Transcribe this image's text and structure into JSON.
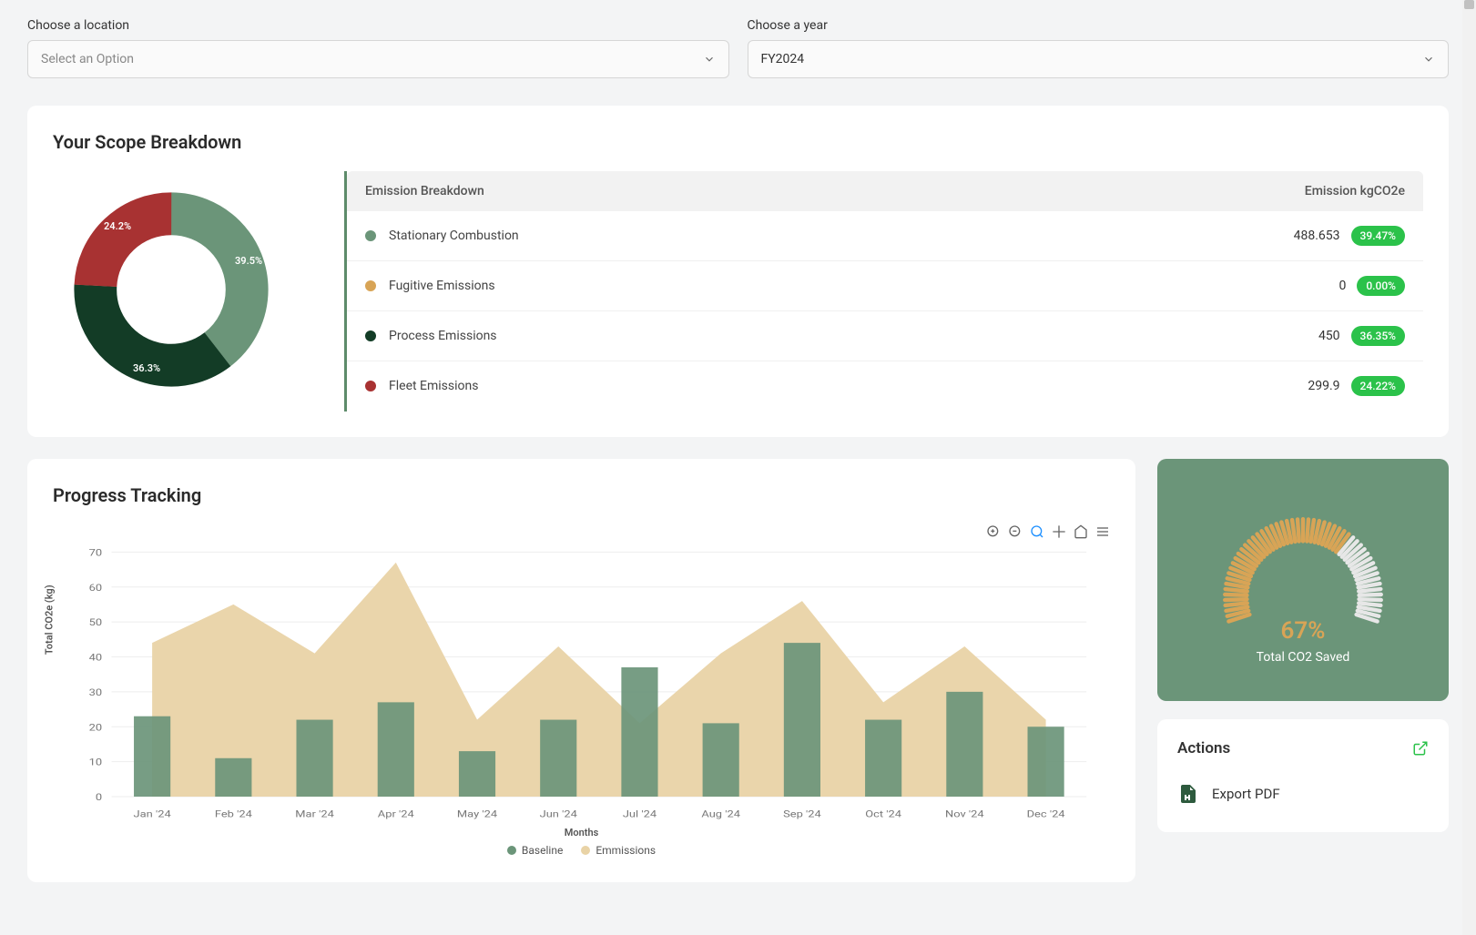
{
  "filters": {
    "location_label": "Choose a location",
    "location_placeholder": "Select an Option",
    "year_label": "Choose a year",
    "year_value": "FY2024"
  },
  "scope": {
    "title": "Your Scope Breakdown",
    "table_head_left": "Emission Breakdown",
    "table_head_right": "Emission kgCO2e",
    "rows": [
      {
        "name": "Stationary Combustion",
        "value": "488.653",
        "pct": "39.47%",
        "color": "#6b9579"
      },
      {
        "name": "Fugitive Emissions",
        "value": "0",
        "pct": "0.00%",
        "color": "#d8a456"
      },
      {
        "name": "Process Emissions",
        "value": "450",
        "pct": "36.35%",
        "color": "#133c26"
      },
      {
        "name": "Fleet Emissions",
        "value": "299.9",
        "pct": "24.22%",
        "color": "#a83232"
      }
    ],
    "donut_labels": {
      "a": "39.5%",
      "b": "36.3%",
      "c": "24.2%"
    }
  },
  "progress": {
    "title": "Progress Tracking",
    "y_label": "Total CO2e (kg)",
    "x_label": "Months",
    "legend_a": "Baseline",
    "legend_b": "Emmissions"
  },
  "gauge": {
    "pct": "67%",
    "label": "Total CO2 Saved"
  },
  "actions": {
    "title": "Actions",
    "items": [
      {
        "label": "Export PDF"
      }
    ]
  },
  "chart_data": [
    {
      "type": "pie",
      "title": "Your Scope Breakdown",
      "series": [
        {
          "name": "Stationary Combustion",
          "value": 39.47,
          "color": "#6b9579"
        },
        {
          "name": "Fugitive Emissions",
          "value": 0.0,
          "color": "#d8a456"
        },
        {
          "name": "Process Emissions",
          "value": 36.35,
          "color": "#133c26"
        },
        {
          "name": "Fleet Emissions",
          "value": 24.22,
          "color": "#a83232"
        }
      ]
    },
    {
      "type": "bar",
      "title": "Progress Tracking",
      "xlabel": "Months",
      "ylabel": "Total CO2e (kg)",
      "ylim": [
        0,
        70
      ],
      "categories": [
        "Jan '24",
        "Feb '24",
        "Mar '24",
        "Apr '24",
        "May '24",
        "Jun '24",
        "Jul '24",
        "Aug '24",
        "Sep '24",
        "Oct '24",
        "Nov '24",
        "Dec '24"
      ],
      "series": [
        {
          "name": "Baseline",
          "type": "bar",
          "color": "#6b9579",
          "values": [
            23,
            11,
            22,
            27,
            13,
            22,
            37,
            21,
            44,
            22,
            30,
            20
          ]
        },
        {
          "name": "Emmissions",
          "type": "area",
          "color": "#e9d3a6",
          "values": [
            44,
            55,
            41,
            67,
            22,
            43,
            21,
            41,
            56,
            27,
            43,
            22
          ]
        }
      ]
    },
    {
      "type": "gauge",
      "title": "Total CO2 Saved",
      "value": 67,
      "max": 100,
      "unit": "%"
    }
  ]
}
